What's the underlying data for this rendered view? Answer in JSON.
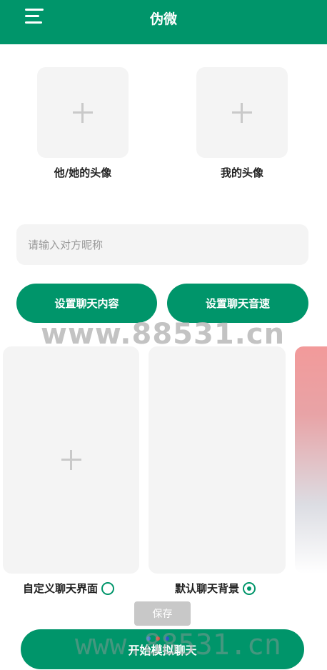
{
  "header": {
    "title": "伪微",
    "bg_color": "#00956a"
  },
  "avatars": {
    "other_label": "他/她的头像",
    "mine_label": "我的头像"
  },
  "nickname": {
    "placeholder": "请输入对方昵称",
    "value": ""
  },
  "buttons": {
    "set_content": "设置聊天内容",
    "set_speed": "设置聊天音速",
    "save": "保存",
    "start": "开始模拟聊天"
  },
  "backgrounds": {
    "custom_label": "自定义聊天界面",
    "default_label": "默认聊天背景",
    "selected": "default"
  },
  "watermark": {
    "text": "www.88531.cn"
  },
  "icons": {
    "menu": "menu-icon",
    "plus": "plus-icon"
  }
}
